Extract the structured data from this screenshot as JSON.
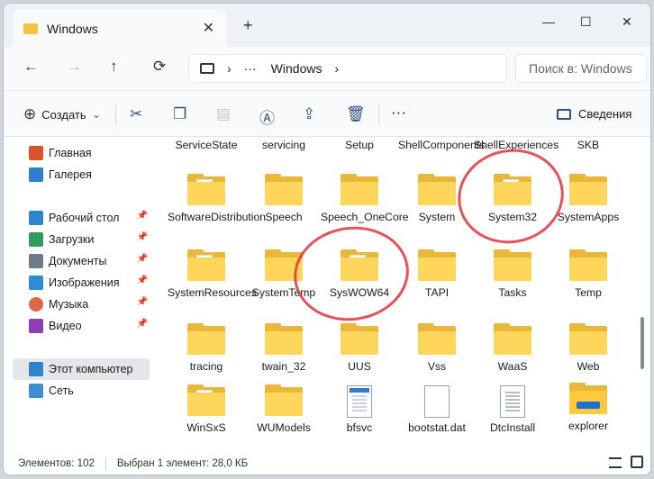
{
  "window": {
    "tab_title": "Windows",
    "tab_close": "✕",
    "new_tab": "+",
    "minimize": "—",
    "maximize": "☐",
    "close": "✕"
  },
  "nav": {
    "back": "←",
    "forward": "→",
    "up": "↑",
    "refresh": "⟳"
  },
  "address": {
    "computer_icon": "computer-icon",
    "chevron": "›",
    "more": "···",
    "current": "Windows",
    "trailing_chevron": "›"
  },
  "search": {
    "placeholder": "Поиск в: Windows"
  },
  "commandbar": {
    "create_label": "Создать",
    "create_icon": "⊕",
    "create_caret": "⌄",
    "more": "···",
    "details_label": "Сведения"
  },
  "sidebar": {
    "items": [
      {
        "label": "Главная",
        "color": "#d9532c"
      },
      {
        "label": "Галерея",
        "color": "#2f7fd1"
      },
      {
        "label": "Рабочий стол",
        "color": "#2d84c9",
        "pinned": "📌"
      },
      {
        "label": "Загрузки",
        "color": "#2e9c5e",
        "pinned": "📌"
      },
      {
        "label": "Документы",
        "color": "#6f7b88",
        "pinned": "📌"
      },
      {
        "label": "Изображения",
        "color": "#2f8ad8",
        "pinned": "📌"
      },
      {
        "label": "Музыка",
        "color": "#e0644a",
        "pinned": "📌"
      },
      {
        "label": "Видео",
        "color": "#8a3fb3",
        "pinned": "📌"
      },
      {
        "label": "Этот компьютер",
        "color": "#2d84c9"
      },
      {
        "label": "Сеть",
        "color": "#3e8fd0"
      }
    ]
  },
  "files": {
    "row0": [
      "ServiceState",
      "servicing",
      "Setup",
      "ShellComponents",
      "ShellExperiences",
      "SKB"
    ],
    "row1": [
      "SoftwareDistribution",
      "Speech",
      "Speech_OneCore",
      "System",
      "System32",
      "SystemApps"
    ],
    "row2": [
      "SystemResources",
      "SystemTemp",
      "SysWOW64",
      "TAPI",
      "Tasks",
      "Temp"
    ],
    "row3": [
      "tracing",
      "twain_32",
      "UUS",
      "Vss",
      "WaaS",
      "Web"
    ],
    "row4": [
      "WinSxS",
      "WUModels",
      "bfsvc",
      "bootstat.dat",
      "DtcInstall",
      "explorer"
    ]
  },
  "status": {
    "count": "Элементов: 102",
    "selected": "Выбран 1 элемент: 28,0 КБ"
  },
  "accent": "#e0343a"
}
